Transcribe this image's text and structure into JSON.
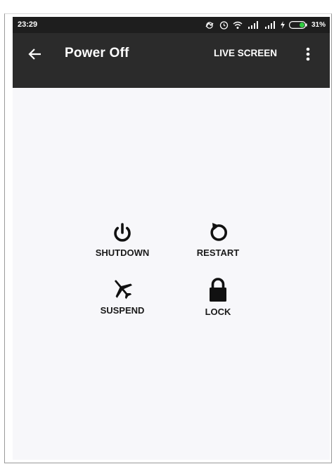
{
  "status_bar": {
    "time": "23:29",
    "battery_percent": "31%",
    "icons": [
      "sync-icon",
      "alarm-icon",
      "wifi-icon",
      "signal-icon",
      "signal-icon",
      "charging-icon",
      "battery-icon"
    ]
  },
  "app_bar": {
    "title": "Power Off",
    "back_icon": "arrow-left-icon",
    "live_screen_label": "LIVE SCREEN",
    "more_icon": "more-vert-icon"
  },
  "actions": {
    "shutdown": {
      "label": "SHUTDOWN",
      "icon": "power-icon"
    },
    "restart": {
      "label": "RESTART",
      "icon": "restart-icon"
    },
    "suspend": {
      "label": "SUSPEND",
      "icon": "airplane-icon"
    },
    "lock": {
      "label": "LOCK",
      "icon": "lock-icon"
    }
  },
  "colors": {
    "status_bar": "#1e1e1e",
    "app_bar": "#2b2b2b",
    "background": "#f7f7fa",
    "battery_accent": "#2ecc40"
  }
}
